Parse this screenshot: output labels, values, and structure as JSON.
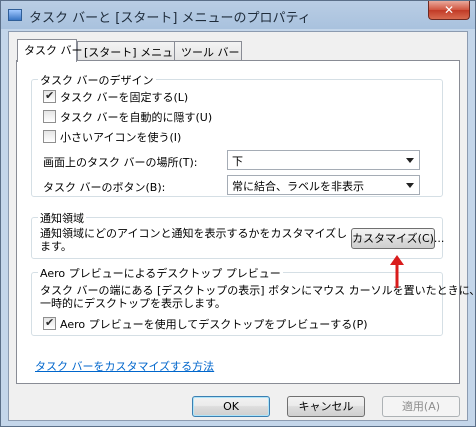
{
  "window": {
    "title": "タスク バーと [スタート] メニューのプロパティ",
    "close_label": "✕"
  },
  "tabs": [
    {
      "label": "タスク バー",
      "active": true
    },
    {
      "label": "[スタート] メニュー",
      "active": false
    },
    {
      "label": "ツール バー",
      "active": false
    }
  ],
  "taskbar_design": {
    "title": "タスク バーのデザイン",
    "lock_taskbar": {
      "label": "タスク バーを固定する(L)",
      "checked": true
    },
    "auto_hide": {
      "label": "タスク バーを自動的に隠す(U)",
      "checked": false
    },
    "small_icons": {
      "label": "小さいアイコンを使う(I)",
      "checked": false
    },
    "location_label": "画面上のタスク バーの場所(T):",
    "location_value": "下",
    "buttons_label": "タスク バーのボタン(B):",
    "buttons_value": "常に結合、ラベルを非表示"
  },
  "notification_area": {
    "title": "通知領域",
    "description": "通知領域にどのアイコンと通知を表示するかをカスタマイズします。",
    "customize_button": "カスタマイズ(C)..."
  },
  "aero_peek": {
    "title": "Aero プレビューによるデスクトップ プレビュー",
    "description_line1": "タスク バーの端にある [デスクトップの表示] ボタンにマウス カーソルを置いたときに、",
    "description_line2": "一時的にデスクトップを表示します。",
    "checkbox": {
      "label": "Aero プレビューを使用してデスクトップをプレビューする(P)",
      "checked": true
    }
  },
  "help_link": "タスク バーをカスタマイズする方法",
  "footer": {
    "ok": "OK",
    "cancel": "キャンセル",
    "apply": "適用(A)"
  },
  "colors": {
    "annotation_arrow": "#d91c1c",
    "link": "#0066cc"
  }
}
